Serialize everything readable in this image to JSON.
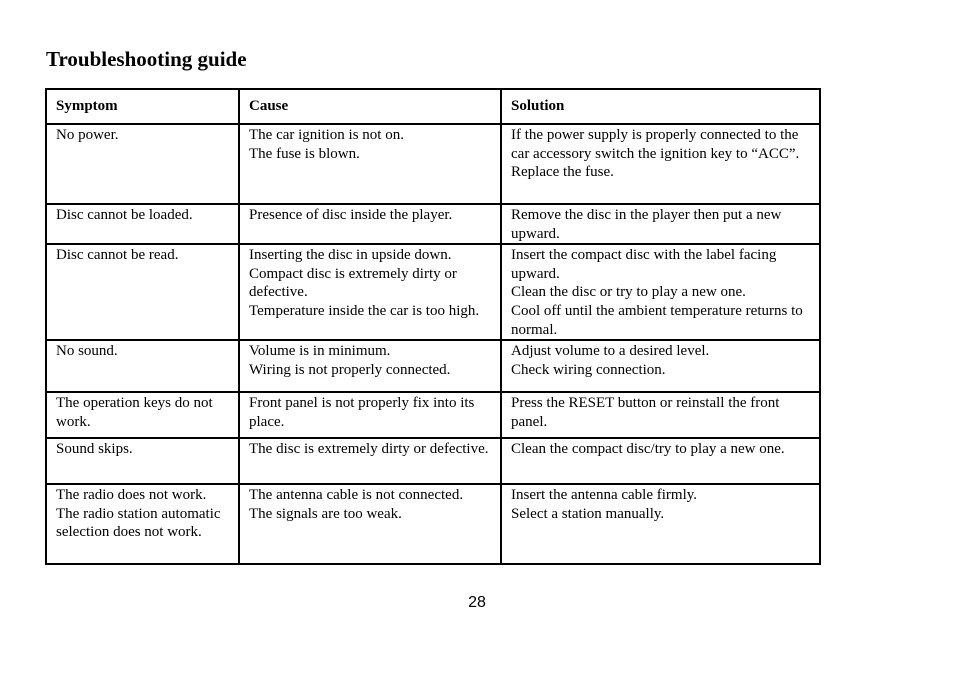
{
  "title": "Troubleshooting guide",
  "table": {
    "headers": [
      "Symptom",
      "Cause",
      "Solution"
    ],
    "rows": [
      {
        "symptom": [
          "No power."
        ],
        "cause": [
          "The car ignition is not on.",
          "The fuse is blown."
        ],
        "solution": [
          "If the power supply is properly connected to the car accessory switch the ignition key to “ACC”.",
          "Replace the fuse."
        ]
      },
      {
        "symptom": [
          "Disc cannot be loaded."
        ],
        "cause": [
          "Presence of disc inside the player."
        ],
        "solution": [
          "Remove the disc in the player then put a new upward."
        ]
      },
      {
        "symptom": [
          "Disc cannot be read."
        ],
        "cause": [
          "Inserting the disc in upside down.",
          "Compact disc is extremely dirty or defective.",
          "Temperature inside the car is too high."
        ],
        "solution": [
          "Insert the compact disc with the label facing upward.",
          "Clean the disc or try to play a new one.",
          "Cool off until the ambient temperature returns to normal."
        ]
      },
      {
        "symptom": [
          "No sound."
        ],
        "cause": [
          "Volume is in minimum.",
          "Wiring is not properly connected."
        ],
        "solution": [
          "Adjust volume to a desired level.",
          "Check wiring connection."
        ]
      },
      {
        "symptom": [
          "The operation keys do not work."
        ],
        "cause": [
          "Front panel is not properly fix into its place."
        ],
        "solution": [
          "Press the RESET button or reinstall the front panel."
        ]
      },
      {
        "symptom": [
          "Sound skips."
        ],
        "cause": [
          "The disc is extremely dirty or defective."
        ],
        "solution": [
          "Clean the compact disc/try to play a new one."
        ]
      },
      {
        "symptom": [
          "The radio does not work.",
          "The radio station automatic selection does not work."
        ],
        "cause": [
          "The antenna cable is not connected.",
          "The signals are too weak."
        ],
        "solution": [
          "Insert the antenna cable firmly.",
          "Select a station manually."
        ]
      }
    ]
  },
  "page_number": "28"
}
